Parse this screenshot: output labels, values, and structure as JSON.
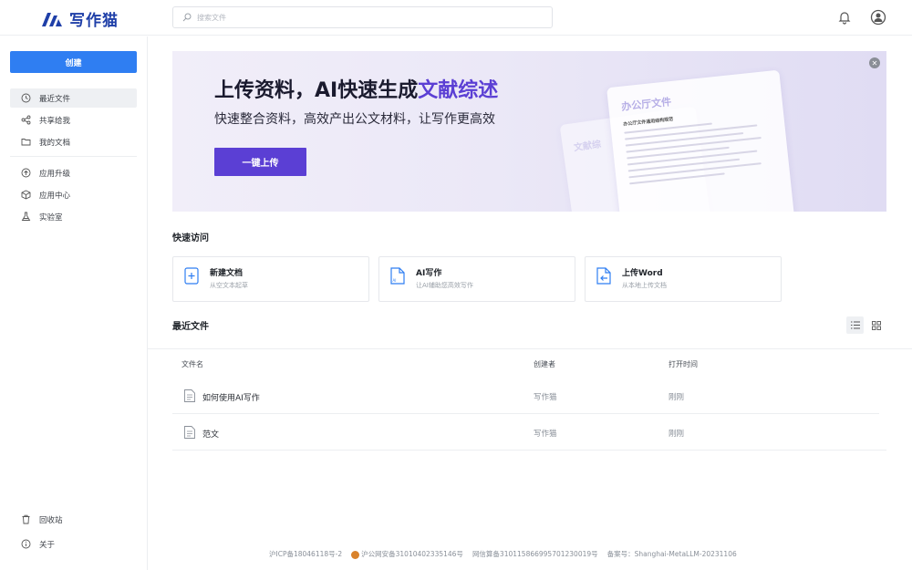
{
  "header": {
    "logo_text": "写作猫",
    "search_placeholder": "搜索文件"
  },
  "sidebar": {
    "create_label": "创建",
    "group1": [
      {
        "label": "最近文件",
        "icon": "clock-icon",
        "active": true
      },
      {
        "label": "共享给我",
        "icon": "share-icon",
        "active": false
      },
      {
        "label": "我的文档",
        "icon": "folder-icon",
        "active": false
      }
    ],
    "group2": [
      {
        "label": "应用升级",
        "icon": "upgrade-icon"
      },
      {
        "label": "应用中心",
        "icon": "cube-icon"
      },
      {
        "label": "实验室",
        "icon": "flask-icon"
      }
    ],
    "bottom": [
      {
        "label": "回收站",
        "icon": "trash-icon"
      },
      {
        "label": "关于",
        "icon": "info-icon"
      }
    ]
  },
  "banner": {
    "title_main": "上传资料，AI快速生成",
    "title_highlight": "文献综述",
    "subtitle": "快速整合资料，高效产出公文材料，让写作更高效",
    "button_label": "一键上传",
    "card_title": "办公厅文件",
    "card_subtitle": "办公厅文件通用结构规范",
    "card_back_title": "文献综"
  },
  "quick_access": {
    "title": "快速访问",
    "items": [
      {
        "name": "新建文档",
        "desc": "从空文本起草",
        "icon": "new-doc-icon"
      },
      {
        "name": "AI写作",
        "desc": "让AI辅助您高效写作",
        "icon": "ai-doc-icon"
      },
      {
        "name": "上传Word",
        "desc": "从本地上传文档",
        "icon": "upload-doc-icon"
      }
    ]
  },
  "recent": {
    "title": "最近文件",
    "columns": {
      "name": "文件名",
      "creator": "创建者",
      "time": "打开时间"
    },
    "rows": [
      {
        "name": "如何使用AI写作",
        "creator": "写作猫",
        "time": "刚刚"
      },
      {
        "name": "范文",
        "creator": "写作猫",
        "time": "刚刚"
      }
    ]
  },
  "footer": {
    "icp": "沪ICP备18046118号-2",
    "police": "沪公网安备31010402335146号",
    "algo": "网信算备310115866995701230019号",
    "record": "备案号：Shanghai-MetaLLM-20231106"
  },
  "colors": {
    "brand": "#1f3fa8",
    "primary": "#2f7ef2",
    "accent": "#5b3fd4"
  }
}
